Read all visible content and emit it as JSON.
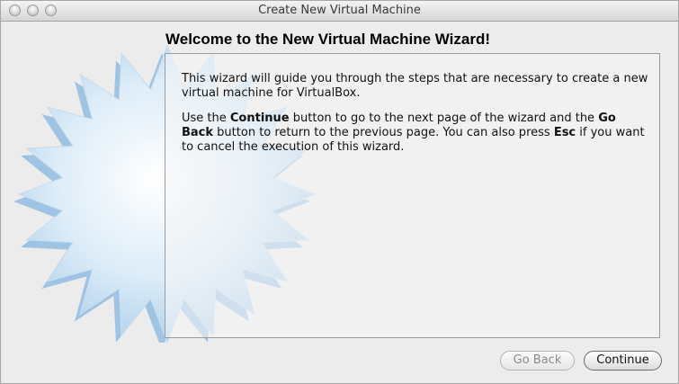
{
  "window": {
    "title": "Create New Virtual Machine"
  },
  "wizard": {
    "heading": "Welcome to the New Virtual Machine Wizard!",
    "para1": "This wizard will guide you through the steps that are necessary to create a new virtual machine for VirtualBox.",
    "para2_parts": [
      "Use the ",
      "Continue",
      " button to go to the next page of the wizard and the ",
      "Go Back",
      " button to return to the previous page. You can also press ",
      "Esc",
      " if you want to cancel the execution of this wizard."
    ]
  },
  "buttons": {
    "back": "Go Back",
    "continue": "Continue"
  },
  "colors": {
    "starburst": "#a9cdea",
    "window_bg": "#ececec"
  }
}
